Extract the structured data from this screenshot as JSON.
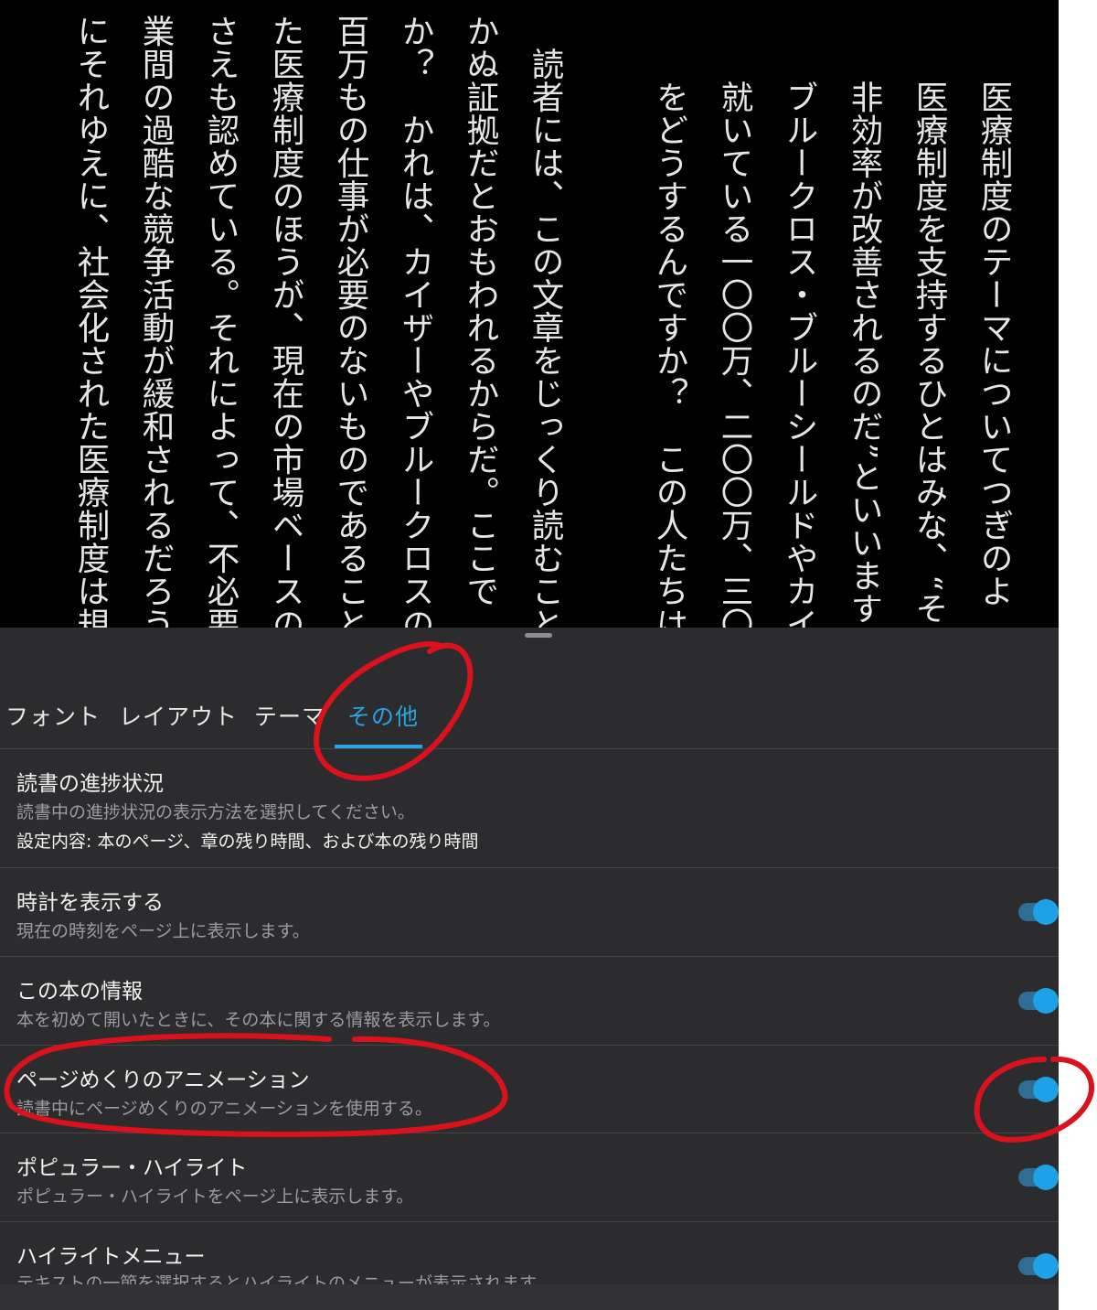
{
  "book": {
    "columns": [
      "医療制度のテーマについてつぎのよ",
      "医療制度を支持するひとはみな、“そ",
      "非効率が改善されるのだ”といいます",
      "ブルークロス・ブルーシールドやカイ",
      "就いている一〇〇万、二〇〇万、三〇",
      "をどうするんですか？　この人たちは",
      "",
      "読者には、この文章をじっくり読むこと",
      "かぬ証拠だとおもわれるからだ。ここで",
      "か？　かれは、カイザーやブルークロスの",
      "百万もの仕事が必要のないものであること",
      "た医療制度のほうが、現在の市場ベースの",
      "さえも認めている。それによって、不必要",
      "業間の過酷な競争活動が緩和されるだろう",
      "にそれゆえに、社会化された医療制度は規"
    ]
  },
  "settings": {
    "tabs": [
      "フォント",
      "レイアウト",
      "テーマ",
      "その他"
    ],
    "active_tab": "その他",
    "rows": [
      {
        "title": "読書の進捗状況",
        "subtitle": "読書中の進捗状況の表示方法を選択してください。",
        "extra": "設定内容: 本のページ、章の残り時間、および本の残り時間"
      },
      {
        "title": "時計を表示する",
        "subtitle": "現在の時刻をページ上に表示します。",
        "on": true
      },
      {
        "title": "この本の情報",
        "subtitle": "本を初めて開いたときに、その本に関する情報を表示します。",
        "on": true
      },
      {
        "title": "ページめくりのアニメーション",
        "subtitle": "読書中にページめくりのアニメーションを使用する。",
        "on": true
      },
      {
        "title": "ポピュラー・ハイライト",
        "subtitle": "ポピュラー・ハイライトをページ上に表示します。",
        "on": true
      },
      {
        "title": "ハイライトメニュー",
        "subtitle": "テキストの一節を選択するとハイライトのメニューが表示されます。",
        "on": true
      }
    ]
  },
  "colors": {
    "accent": "#29a3e6",
    "annotation": "#d9121c",
    "sheet_bg": "#2c2c2e",
    "page_bg": "#000000"
  }
}
